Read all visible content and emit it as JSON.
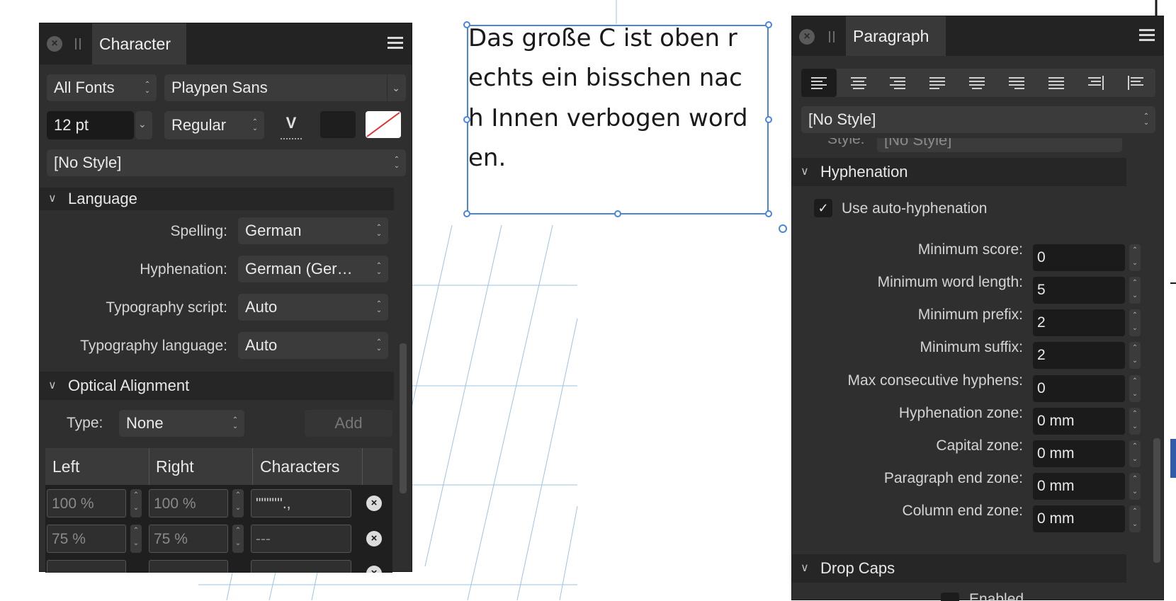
{
  "character_panel": {
    "tab": "Character",
    "font_collection": "All Fonts",
    "font_family": "Playpen Sans",
    "font_size": "12 pt",
    "font_style": "Regular",
    "style": "[No Style]",
    "language_section": "Language",
    "spelling_label": "Spelling:",
    "spelling_value": "German",
    "hyphenation_label": "Hyphenation:",
    "hyphenation_value": "German (Ger…",
    "typo_script_label": "Typography script:",
    "typo_script_value": "Auto",
    "typo_lang_label": "Typography language:",
    "typo_lang_value": "Auto",
    "optical_section": "Optical Alignment",
    "type_label": "Type:",
    "type_value": "None",
    "add_label": "Add",
    "table": {
      "headers": [
        "Left",
        "Right",
        "Characters"
      ],
      "rows": [
        {
          "left": "100 %",
          "right": "100 %",
          "chars": "\"\"\"\"''.,"
        },
        {
          "left": "75 %",
          "right": "75 %",
          "chars": "---"
        }
      ]
    }
  },
  "document": {
    "text_lines": [
      "Das große C ist oben r",
      "echts ein bisschen nac",
      "h Innen verbogen word",
      "en."
    ]
  },
  "paragraph_panel": {
    "tab": "Paragraph",
    "style": "[No Style]",
    "partial_style_label": "Style:",
    "partial_style_value": "[No Style]",
    "hyphenation_section": "Hyphenation",
    "auto_hyph_label": "Use auto-hyphenation",
    "auto_hyph_checked": "✓",
    "fields": [
      {
        "label": "Minimum score:",
        "value": "0"
      },
      {
        "label": "Minimum word length:",
        "value": "5"
      },
      {
        "label": "Minimum prefix:",
        "value": "2"
      },
      {
        "label": "Minimum suffix:",
        "value": "2"
      },
      {
        "label": "Max consecutive hyphens:",
        "value": "0"
      },
      {
        "label": "Hyphenation zone:",
        "value": "0 mm"
      },
      {
        "label": "Capital zone:",
        "value": "0 mm"
      },
      {
        "label": "Paragraph end zone:",
        "value": "0 mm"
      },
      {
        "label": "Column end zone:",
        "value": "0 mm"
      }
    ],
    "drop_caps_section": "Drop Caps",
    "enabled_label": "Enabled"
  },
  "colors": {
    "panel_bg": "#2f2f2f",
    "selection_blue": "#4a86d8",
    "guide_blue": "#9cc3e6"
  }
}
